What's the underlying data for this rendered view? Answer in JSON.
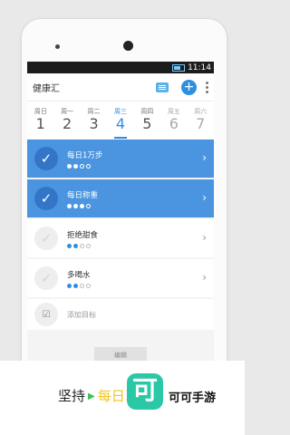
{
  "status": {
    "time": "11:14"
  },
  "app": {
    "title": "健康汇"
  },
  "days": [
    {
      "label": "周日",
      "num": "1"
    },
    {
      "label": "周一",
      "num": "2"
    },
    {
      "label": "周二",
      "num": "3"
    },
    {
      "label": "周三",
      "num": "4",
      "active": true
    },
    {
      "label": "周四",
      "num": "5"
    },
    {
      "label": "周五",
      "num": "6",
      "weekend": true
    },
    {
      "label": "周六",
      "num": "7",
      "weekend": true
    }
  ],
  "goals": [
    {
      "name": "每日1万步",
      "done": true,
      "progress": [
        1,
        1,
        0,
        0
      ]
    },
    {
      "name": "每日称重",
      "done": true,
      "progress": [
        1,
        1,
        1,
        0
      ]
    },
    {
      "name": "拒绝甜食",
      "done": false,
      "progress": [
        1,
        1,
        0,
        0
      ]
    },
    {
      "name": "多喝水",
      "done": false,
      "progress": [
        1,
        1,
        0,
        0
      ]
    }
  ],
  "add_goal": "添加目标",
  "edit": "编辑",
  "slogan": {
    "prefix": "坚持",
    "highlight": "每日习惯"
  },
  "brand": {
    "logo_char": "可",
    "name": "可可手游"
  },
  "colors": {
    "accent": "#2f8ee0",
    "done_bg": "#4b95e0",
    "logo": "#2ac8a6"
  }
}
